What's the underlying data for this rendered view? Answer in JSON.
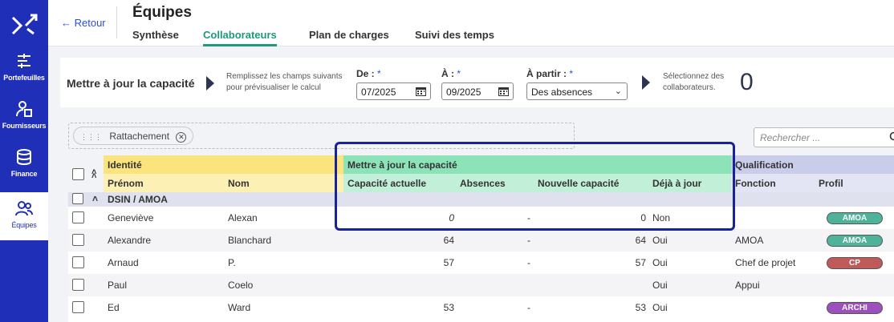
{
  "colors": {
    "sidebar": "#1f2fb8",
    "accent_green": "#1c9a7a",
    "link_blue": "#2a4fd0",
    "highlight_border": "#16239a"
  },
  "sidebar": {
    "logo_icon": "logo-x-icon",
    "items": [
      {
        "label": "Portefeuilles",
        "icon": "portfolio-icon",
        "active": false
      },
      {
        "label": "Fournisseurs",
        "icon": "supplier-icon",
        "active": false
      },
      {
        "label": "Finance",
        "icon": "finance-icon",
        "active": false
      },
      {
        "label": "Équipes",
        "icon": "team-icon",
        "active": true
      }
    ]
  },
  "header": {
    "back_label": "← Retour",
    "title": "Équipes",
    "tabs": [
      {
        "label": "Synthèse",
        "active": false
      },
      {
        "label": "Collaborateurs",
        "active": true
      },
      {
        "label": "Plan de charges",
        "active": false
      },
      {
        "label": "Suivi des temps",
        "active": false
      }
    ]
  },
  "capacity_panel": {
    "title": "Mettre à jour la capacité",
    "hint": [
      "Remplissez les champs suivants",
      "pour prévisualiser le calcul"
    ],
    "from": {
      "label": "De :",
      "required_mark": "*",
      "value": "07/2025"
    },
    "to": {
      "label": "À :",
      "required_mark": "*",
      "value": "09/2025"
    },
    "starting": {
      "label": "À partir :",
      "required_mark": "*",
      "value": "Des absences"
    },
    "select_hint": [
      "Sélectionnez des",
      "collaborateurs."
    ],
    "selected_count": "0"
  },
  "group_zone": {
    "chip_label": "Rattachement"
  },
  "search": {
    "placeholder": "Rechercher ..."
  },
  "grid": {
    "group_headers": {
      "identite": "Identité",
      "maj": "Mettre à jour la capacité",
      "qualification": "Qualification"
    },
    "columns": {
      "prenom": "Prénom",
      "nom": "Nom",
      "capacite_actuelle": "Capacité actuelle",
      "absences": "Absences",
      "nouvelle_capacite": "Nouvelle capacité",
      "deja_a_jour": "Déjà à jour",
      "fonction": "Fonction",
      "profil": "Profil"
    },
    "group_row": "DSIN / AMOA",
    "rows": [
      {
        "prenom": "Geneviève",
        "nom": "Alexan",
        "capacite": "0",
        "absences": "-",
        "nouvelle": "0",
        "deja": "Non",
        "fonction": "",
        "profil": "AMOA",
        "profil_color": "#4fb39a"
      },
      {
        "prenom": "Alexandre",
        "nom": "Blanchard",
        "capacite": "64",
        "absences": "-",
        "nouvelle": "64",
        "deja": "Oui",
        "fonction": "AMOA",
        "profil": "AMOA",
        "profil_color": "#4fb39a"
      },
      {
        "prenom": "Arnaud",
        "nom": "P.",
        "capacite": "57",
        "absences": "-",
        "nouvelle": "57",
        "deja": "Oui",
        "fonction": "Chef de projet",
        "profil": "CP",
        "profil_color": "#c05a5a"
      },
      {
        "prenom": "Paul",
        "nom": "Coelo",
        "capacite": "",
        "absences": "",
        "nouvelle": "",
        "deja": "Oui",
        "fonction": "Appui",
        "profil": "",
        "profil_color": ""
      },
      {
        "prenom": "Ed",
        "nom": "Ward",
        "capacite": "53",
        "absences": "-",
        "nouvelle": "53",
        "deja": "Oui",
        "fonction": "",
        "profil": "ARCHI",
        "profil_color": "#9e4fbe"
      }
    ]
  }
}
